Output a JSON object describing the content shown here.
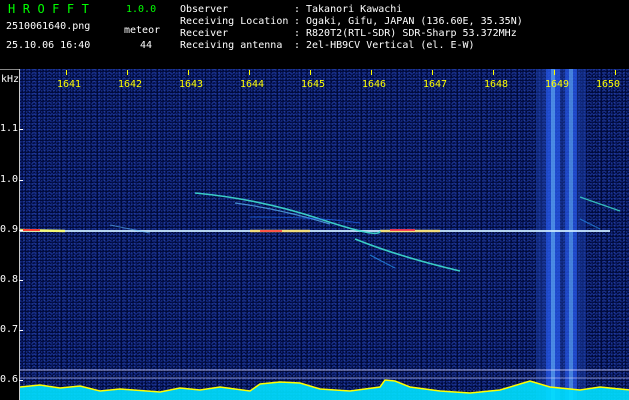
{
  "header": {
    "app_name": "HROFFT",
    "version": "1.0.0",
    "file_name": "2510061640.png",
    "datetime": "25.10.06 16:40",
    "meteor_label": "meteor",
    "meteor_count": "44"
  },
  "station_info": [
    {
      "label": "Observer",
      "value": "Takanori Kawachi"
    },
    {
      "label": "Receiving Location",
      "value": "Ogaki, Gifu, JAPAN (136.60E, 35.35N)"
    },
    {
      "label": "Receiver",
      "value": "R820T2(RTL-SDR) SDR-Sharp 53.372MHz"
    },
    {
      "label": "Receiving antenna",
      "value": "2el-HB9CV Vertical (el. E-W)"
    }
  ],
  "spectrogram": {
    "frequency_unit": "kHz",
    "frequency_labels": [
      "1.1",
      "1.0",
      "0.9",
      "0.8",
      "0.7",
      "0.6"
    ],
    "time_labels": [
      "1641",
      "1642",
      "1643",
      "1644",
      "1645",
      "1646",
      "1647",
      "1648",
      "1649",
      "1650"
    ],
    "colors": {
      "background": "#000a3a",
      "carrier": "#c8e8ff",
      "trail": "#40e0d0",
      "hot": "#ff3030",
      "noise_band": "#2a60ff",
      "floor_fill": "#00e0ff",
      "floor_peak": "#ffff00"
    }
  }
}
